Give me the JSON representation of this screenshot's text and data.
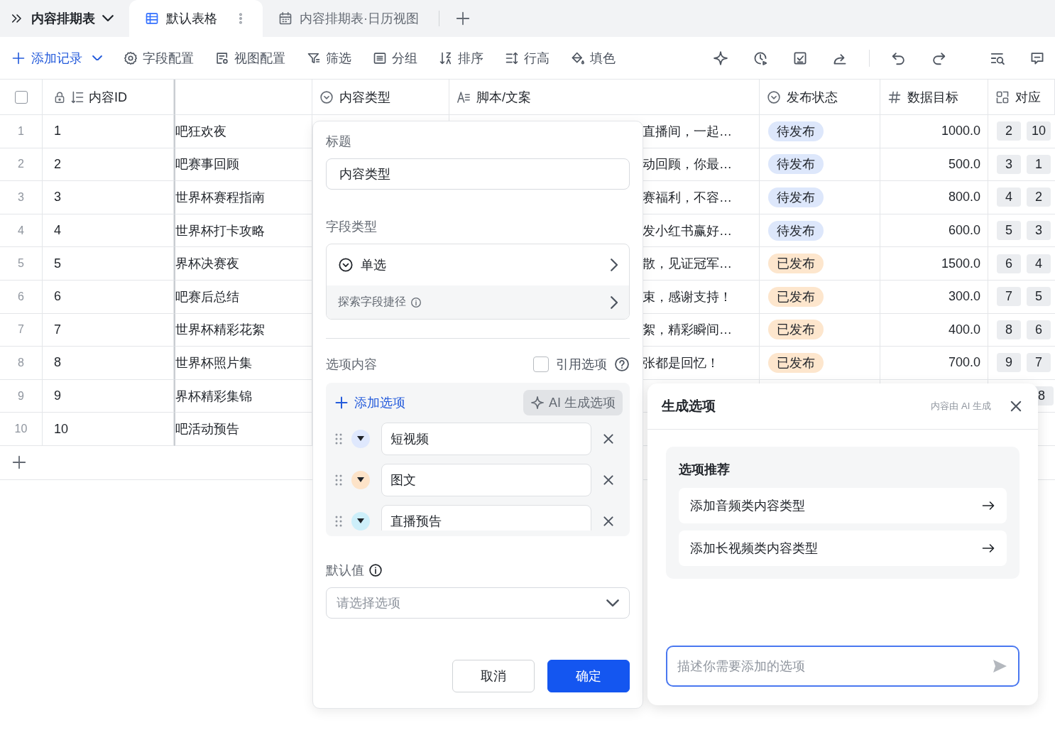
{
  "tabs_bar": {
    "base_name": "内容排期表",
    "tabs": [
      {
        "label": "默认表格",
        "selected": true
      },
      {
        "label": "内容排期表·日历视图",
        "selected": false
      }
    ]
  },
  "toolbar": {
    "add_record": "添加记录",
    "items": [
      {
        "label": "字段配置"
      },
      {
        "label": "视图配置"
      },
      {
        "label": "筛选"
      },
      {
        "label": "分组"
      },
      {
        "label": "排序"
      },
      {
        "label": "行高"
      },
      {
        "label": "填色"
      }
    ]
  },
  "table": {
    "header_checkbox": {
      "checked": false
    },
    "columns": [
      {
        "kind": "id",
        "label": "内容ID"
      },
      {
        "kind": "blank"
      },
      {
        "kind": "select",
        "label": "内容类型"
      },
      {
        "kind": "text",
        "label": "脚本/文案"
      },
      {
        "kind": "select",
        "label": "发布状态"
      },
      {
        "kind": "number",
        "label": "数据目标"
      },
      {
        "kind": "link",
        "label": "对应"
      }
    ],
    "rows": [
      {
        "index": "1",
        "id": "1",
        "title": "吧狂欢夜",
        "script": "直播间，一起…",
        "status": {
          "label": "待发布",
          "color": "#dde7fb"
        },
        "target": "1000.0",
        "related": [
          "2",
          "10"
        ]
      },
      {
        "index": "2",
        "id": "2",
        "title": "吧赛事回顾",
        "script": "动回顾，你最…",
        "status": {
          "label": "待发布",
          "color": "#dde7fb"
        },
        "target": "500.0",
        "related": [
          "3",
          "1"
        ]
      },
      {
        "index": "3",
        "id": "3",
        "title": "世界杯赛程指南",
        "script": "赛福利，不容…",
        "status": {
          "label": "待发布",
          "color": "#dde7fb"
        },
        "target": "800.0",
        "related": [
          "4",
          "2"
        ]
      },
      {
        "index": "4",
        "id": "4",
        "title": "世界杯打卡攻略",
        "script": "发小红书赢好…",
        "status": {
          "label": "待发布",
          "color": "#dde7fb"
        },
        "target": "600.0",
        "related": [
          "5",
          "3"
        ]
      },
      {
        "index": "5",
        "id": "5",
        "title": "界杯决赛夜",
        "script": "散，见证冠军…",
        "status": {
          "label": "已发布",
          "color": "#fde6cd"
        },
        "target": "1500.0",
        "related": [
          "6",
          "4"
        ]
      },
      {
        "index": "6",
        "id": "6",
        "title": "吧赛后总结",
        "script": "束，感谢支持！",
        "status": {
          "label": "已发布",
          "color": "#fde6cd"
        },
        "target": "300.0",
        "related": [
          "7",
          "5"
        ]
      },
      {
        "index": "7",
        "id": "7",
        "title": "世界杯精彩花絮",
        "script": "絮，精彩瞬间…",
        "status": {
          "label": "已发布",
          "color": "#fde6cd"
        },
        "target": "400.0",
        "related": [
          "8",
          "6"
        ]
      },
      {
        "index": "8",
        "id": "8",
        "title": "世界杯照片集",
        "script": "张都是回忆！",
        "status": {
          "label": "已发布",
          "color": "#fde6cd"
        },
        "target": "700.0",
        "related": [
          "9",
          "7"
        ]
      },
      {
        "index": "9",
        "id": "9",
        "title": "界杯精彩集锦",
        "related": [
          "8"
        ]
      },
      {
        "index": "10",
        "id": "10",
        "title": "吧活动预告"
      }
    ]
  },
  "field_panel": {
    "title_label": "标题",
    "title_value": "内容类型",
    "type_label": "字段类型",
    "type_value": "单选",
    "shortcut": "探索字段捷径",
    "options_label": "选项内容",
    "reference": {
      "label": "引用选项",
      "checked": false
    },
    "add_option": "添加选项",
    "ai_button": {
      "label": "AI 生成选项",
      "selected": true
    },
    "options": [
      {
        "label": "短视频",
        "color": "#dfe8fd"
      },
      {
        "label": "图文",
        "color": "#fde3c8"
      },
      {
        "label": "直播预告",
        "color": "#cdeffa"
      }
    ],
    "default_label": "默认值",
    "default_placeholder": "请选择选项",
    "cancel": "取消",
    "confirm": "确定"
  },
  "ai_panel": {
    "title": "生成选项",
    "note": "内容由 AI 生成",
    "section_title": "选项推荐",
    "suggestions": [
      "添加音频类内容类型",
      "添加长视频类内容类型"
    ],
    "input_placeholder": "描述你需要添加的选项"
  }
}
